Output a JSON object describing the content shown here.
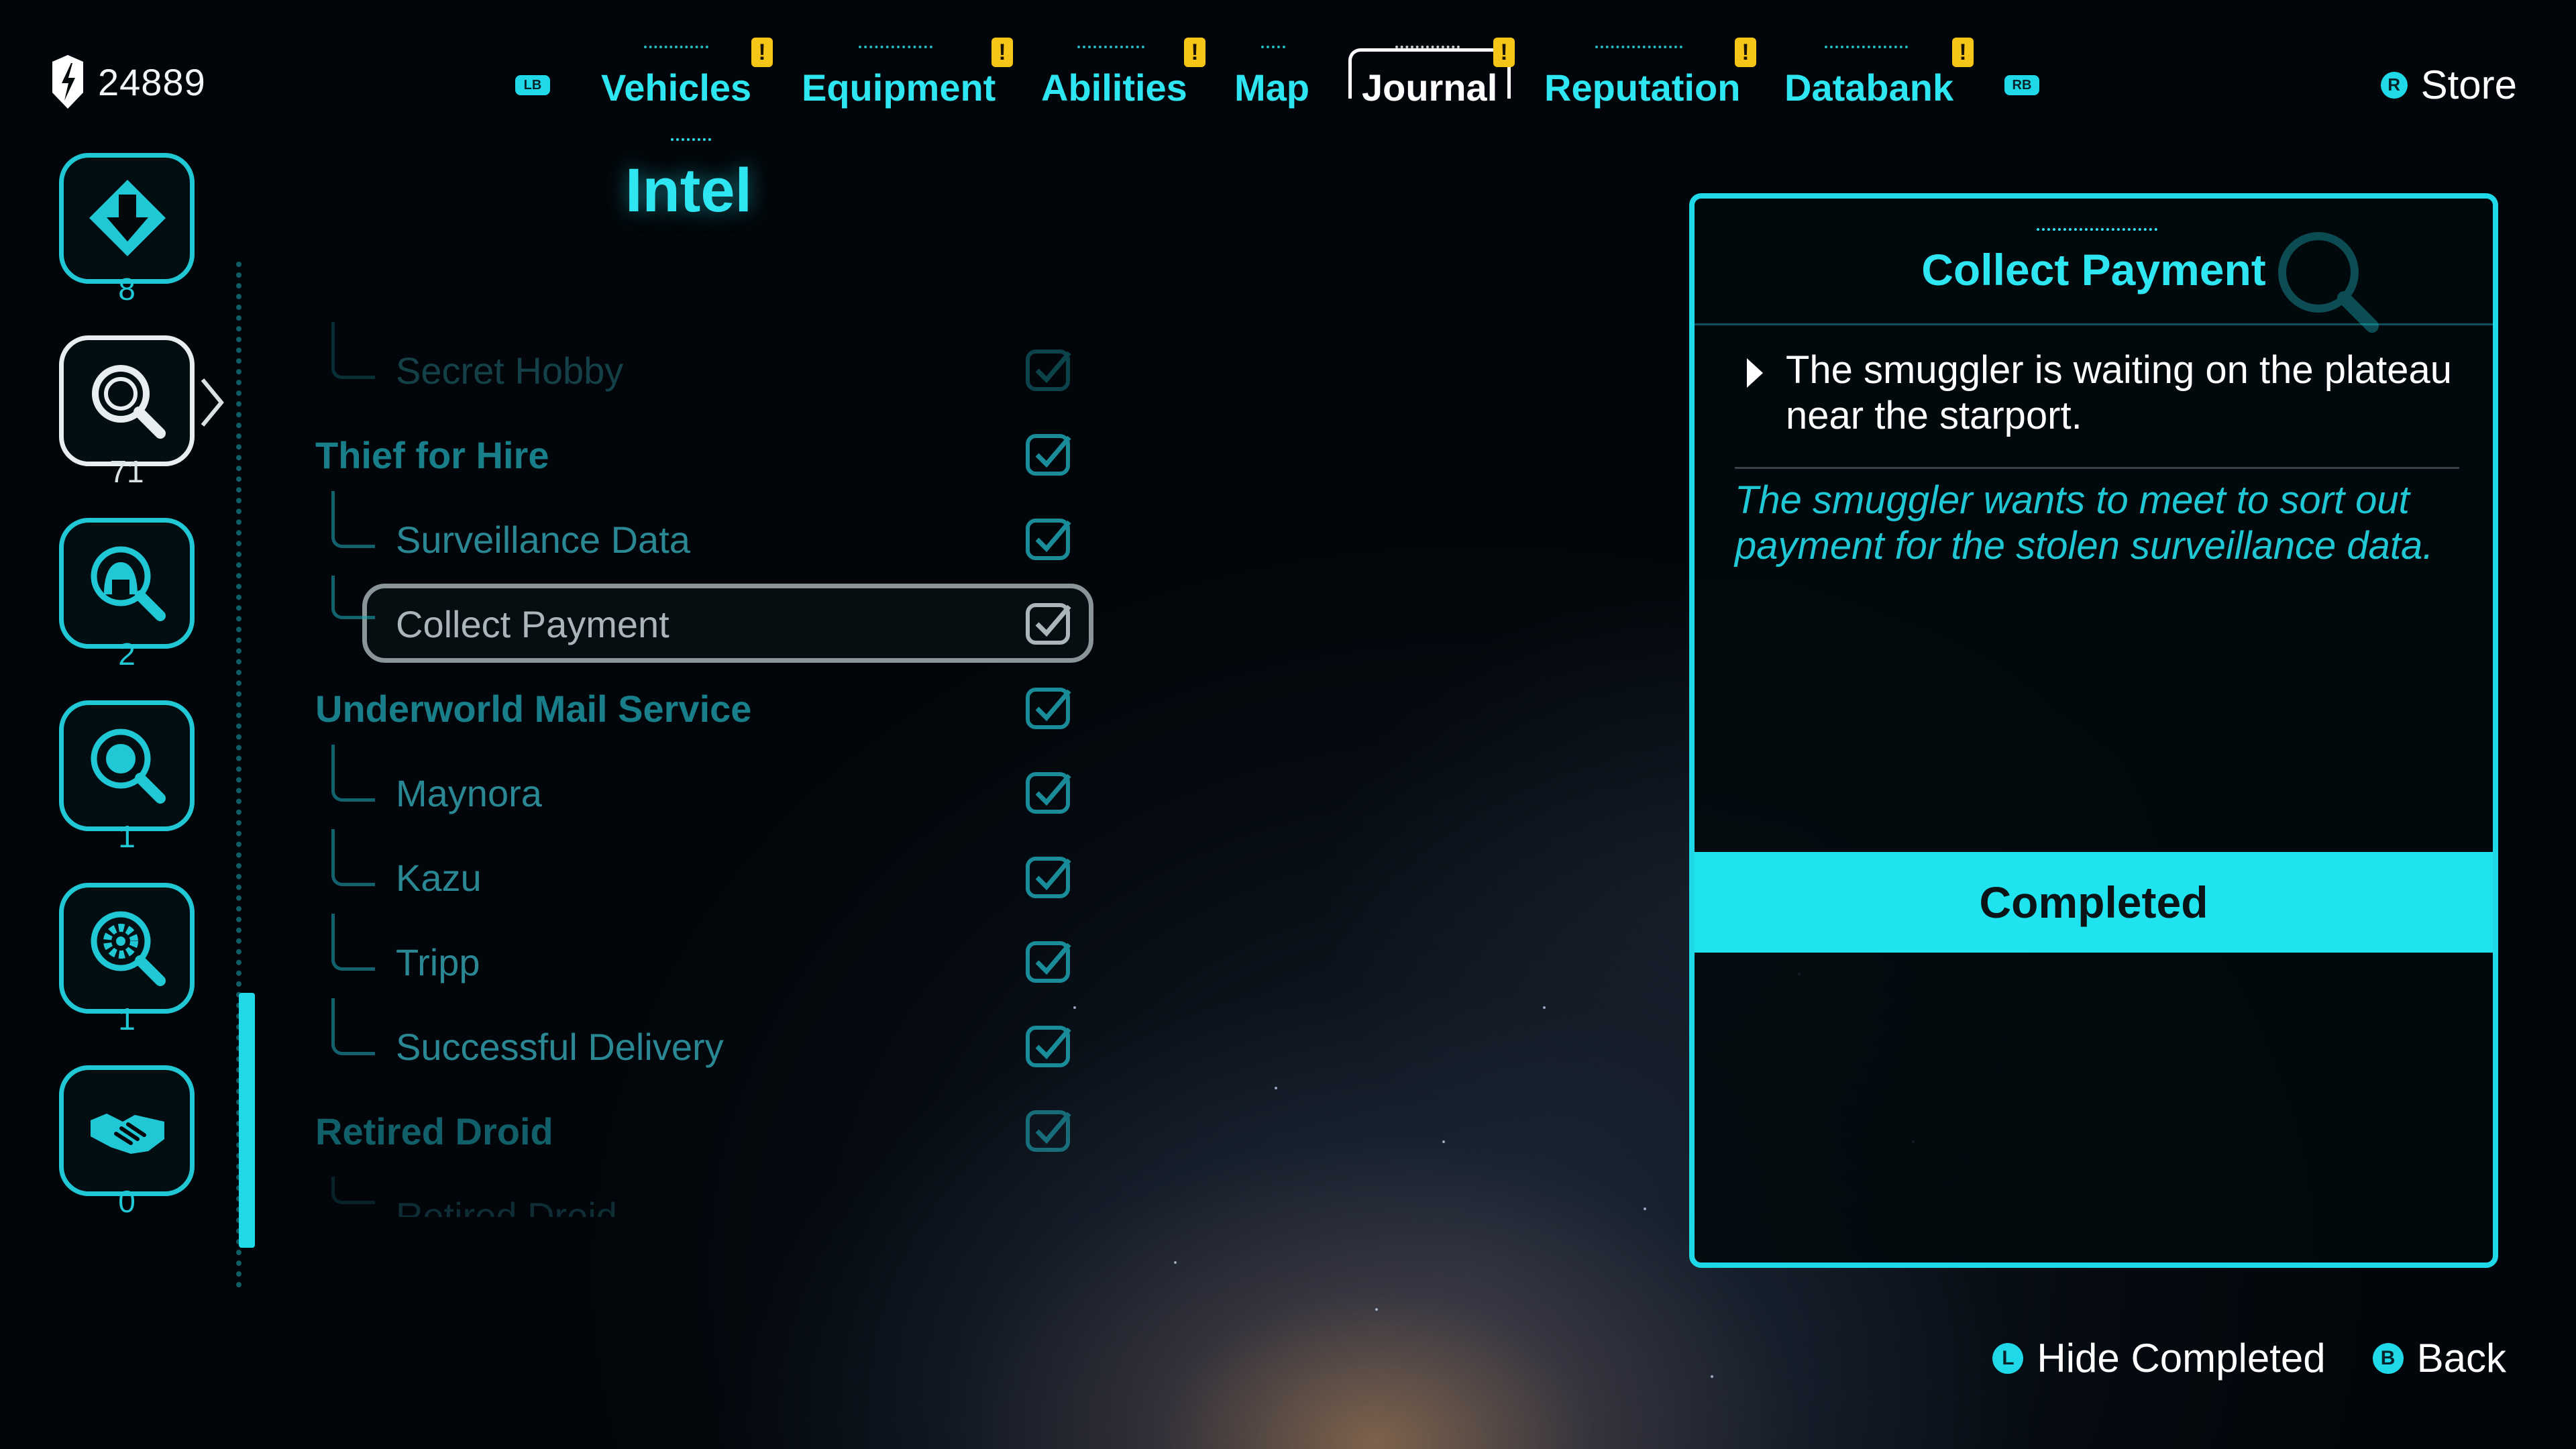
{
  "credits": {
    "value": "24889",
    "icon": "credits-icon"
  },
  "nav": {
    "left_button": "LB",
    "right_button": "RB",
    "tabs": [
      {
        "label": "Vehicles",
        "alert": "!"
      },
      {
        "label": "Equipment",
        "alert": "!"
      },
      {
        "label": "Abilities",
        "alert": "!"
      },
      {
        "label": "Map",
        "alert": ""
      },
      {
        "label": "Journal",
        "alert": "!",
        "active": true
      },
      {
        "label": "Reputation",
        "alert": "!"
      },
      {
        "label": "Databank",
        "alert": "!"
      }
    ],
    "store_button": "R",
    "store_label": "Store"
  },
  "categories": [
    {
      "icon": "download-arrow-icon",
      "count": "8"
    },
    {
      "icon": "search-icon",
      "count": "71",
      "selected": true
    },
    {
      "icon": "person-search-icon",
      "count": "2"
    },
    {
      "icon": "planet-search-icon",
      "count": "1"
    },
    {
      "icon": "gear-search-icon",
      "count": "1"
    },
    {
      "icon": "handshake-icon",
      "count": "0"
    }
  ],
  "intel": {
    "title": "Intel",
    "rows": [
      {
        "type": "sub",
        "label": "Secret Hobby"
      },
      {
        "type": "header",
        "label": "Thief for Hire"
      },
      {
        "type": "sub",
        "label": "Surveillance Data"
      },
      {
        "type": "sub",
        "label": "Collect Payment",
        "focused": true
      },
      {
        "type": "header",
        "label": "Underworld Mail Service"
      },
      {
        "type": "sub",
        "label": "Maynora"
      },
      {
        "type": "sub",
        "label": "Kazu"
      },
      {
        "type": "sub",
        "label": "Tripp"
      },
      {
        "type": "sub",
        "label": "Successful Delivery"
      },
      {
        "type": "header",
        "label": "Retired Droid"
      },
      {
        "type": "sub",
        "label": "Retired Droid"
      }
    ]
  },
  "detail": {
    "title": "Collect Payment",
    "objective": "The smuggler is waiting on the plateau near the starport.",
    "description": "The smuggler wants to meet to sort out payment for the stolen surveillance data.",
    "status": "Completed"
  },
  "hints": {
    "hide_button": "L",
    "hide_label": "Hide Completed",
    "back_button": "B",
    "back_label": "Back"
  },
  "colors": {
    "accent": "#1fd8e8",
    "alert": "#f5c518"
  }
}
